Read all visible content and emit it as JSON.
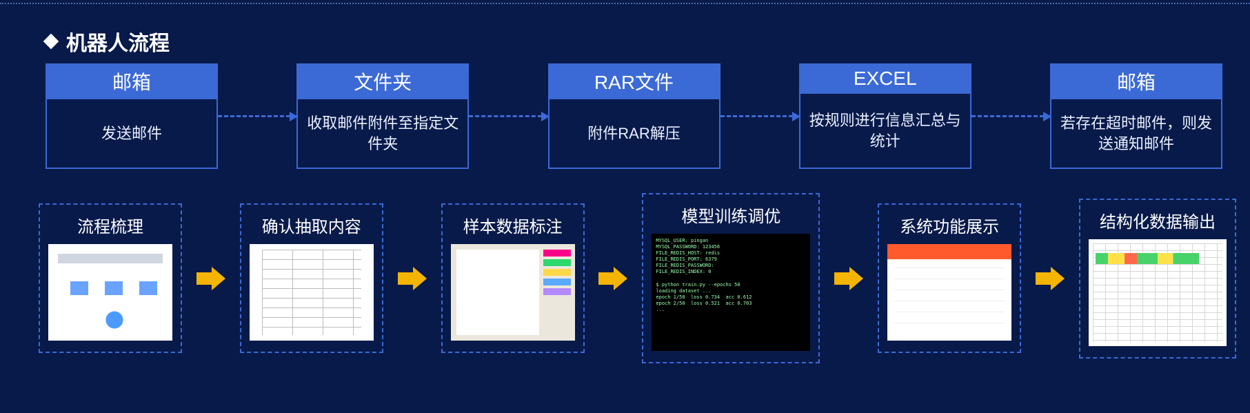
{
  "title": "机器人流程",
  "steps": [
    {
      "header": "邮箱",
      "body": "发送邮件"
    },
    {
      "header": "文件夹",
      "body": "收取邮件附件至指定文件夹"
    },
    {
      "header": "RAR文件",
      "body": "附件RAR解压"
    },
    {
      "header": "EXCEL",
      "body": "按规则进行信息汇总与统计"
    },
    {
      "header": "邮箱",
      "body": "若存在超时邮件，则发送通知邮件"
    }
  ],
  "cards": [
    {
      "title": "流程梳理",
      "thumb": "flowchart"
    },
    {
      "title": "确认抽取内容",
      "thumb": "table"
    },
    {
      "title": "样本数据标注",
      "thumb": "doc"
    },
    {
      "title": "模型训练调优",
      "thumb": "terminal"
    },
    {
      "title": "系统功能展示",
      "thumb": "webapp"
    },
    {
      "title": "结构化数据输出",
      "thumb": "sheet"
    }
  ],
  "terminal_text": "MYSQL_USER: pingan\nMYSQL_PASSWORD: 123456\nFILE_REDIS_HOST: redis\nFILE_REDIS_PORT: 6379\nFILE_REDIS_PASSWORD:\nFILE_REDIS_INDEX: 0\n\n$ python train.py --epochs 50\nloading dataset ...\nepoch 1/50  loss 0.734  acc 0.612\nepoch 2/50  loss 0.521  acc 0.703\n..."
}
